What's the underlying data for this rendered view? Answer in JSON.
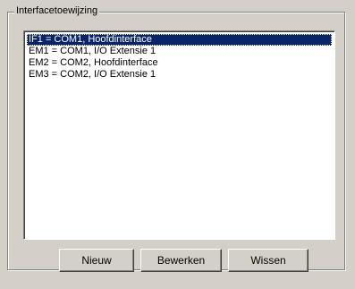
{
  "group": {
    "title": "Interfacetoewijzing"
  },
  "list": {
    "items": [
      {
        "label": "IF1 = COM1, Hoofdinterface",
        "selected": true
      },
      {
        "label": "EM1 = COM1, I/O Extensie 1",
        "selected": false
      },
      {
        "label": "EM2 = COM2, Hoofdinterface",
        "selected": false
      },
      {
        "label": "EM3 = COM2, I/O Extensie 1",
        "selected": false
      }
    ]
  },
  "buttons": {
    "new_label": "Nieuw",
    "edit_label": "Bewerken",
    "delete_label": "Wissen"
  },
  "colors": {
    "window_bg": "#d4d0c8",
    "selection_bg": "#0a246a",
    "selection_text": "#ffffff",
    "list_bg": "#ffffff"
  }
}
